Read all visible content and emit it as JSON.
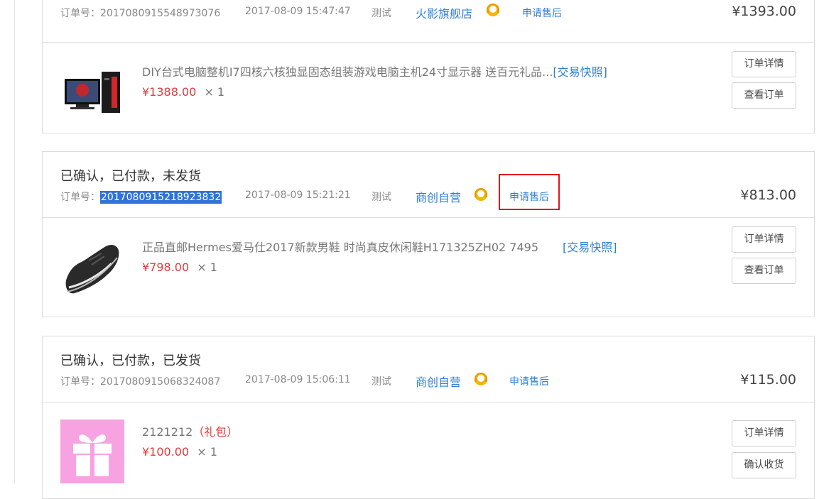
{
  "orders": [
    {
      "status": "",
      "order_label": "订单号：",
      "order_no": "2017080915548973076",
      "date": "2017-08-09 15:47:47",
      "user": "测试",
      "shop": "火影旗舰店",
      "aftersale": "申请售后",
      "total": "¥1393.00",
      "item": {
        "name": "DIY台式电脑整机I7四核六核独显固态组装游戏电脑主机24寸显示器 送百元礼品...",
        "snapshot": "[交易快照]",
        "price": "¥1388.00",
        "qty": "× 1"
      },
      "buttons": [
        "订单详情",
        "查看订单"
      ]
    },
    {
      "status": "已确认，已付款，未发货",
      "order_label": "订单号：",
      "order_no": "2017080915218923832",
      "date": "2017-08-09 15:21:21",
      "user": "测试",
      "shop": "商创自营",
      "aftersale": "申请售后",
      "total": "¥813.00",
      "item": {
        "name": "正品直邮Hermes爱马仕2017新款男鞋 时尚真皮休闲鞋H171325ZH02 7495",
        "snapshot": "[交易快照]",
        "price": "¥798.00",
        "qty": "× 1"
      },
      "buttons": [
        "订单详情",
        "查看订单"
      ]
    },
    {
      "status": "已确认，已付款，已发货",
      "order_label": "订单号：",
      "order_no": "2017080915068324087",
      "date": "2017-08-09 15:06:11",
      "user": "测试",
      "shop": "商创自营",
      "aftersale": "申请售后",
      "total": "¥115.00",
      "item": {
        "name": "2121212",
        "tag": "（礼包）",
        "price": "¥100.00",
        "qty": "× 1"
      },
      "buttons": [
        "订单详情",
        "确认收货"
      ]
    }
  ],
  "colors": {
    "link": "#2d7fd6",
    "price": "#e4393c",
    "highlight": "#2f73d8",
    "annotation_box": "#e0181a"
  },
  "icons": {
    "chat": "customer-service-icon",
    "gift": "gift-icon"
  }
}
